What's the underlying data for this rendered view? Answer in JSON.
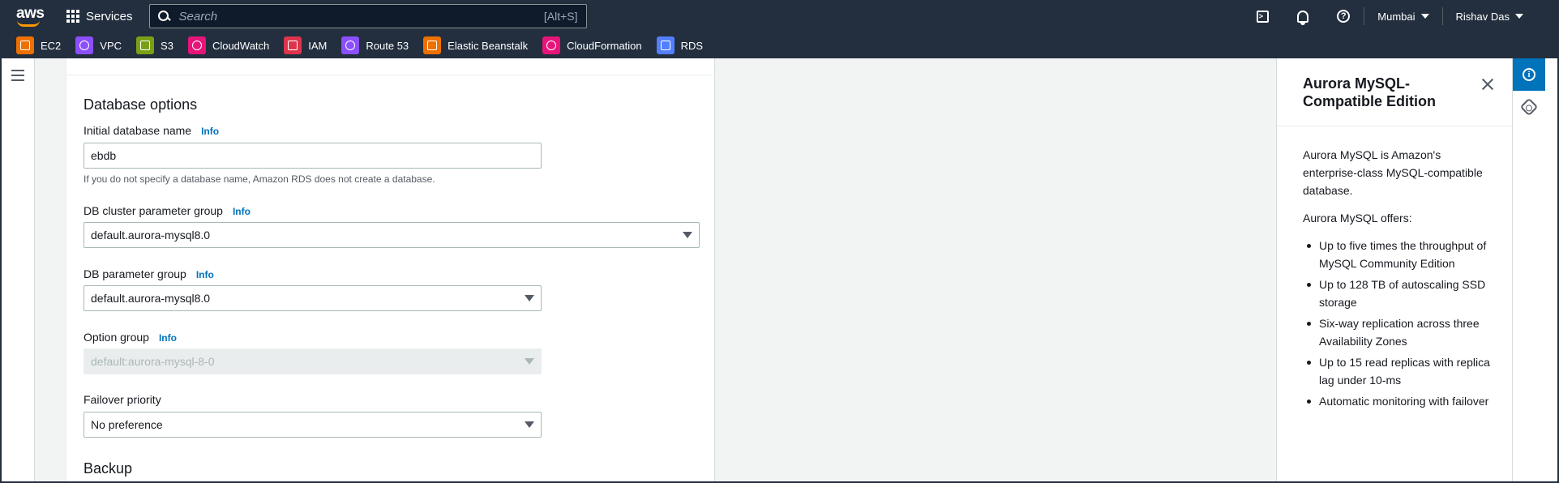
{
  "topnav": {
    "logo_text": "aws",
    "services_label": "Services",
    "search_placeholder": "Search",
    "search_shortcut": "[Alt+S]",
    "region": "Mumbai",
    "user": "Rishav Das"
  },
  "favorites": [
    {
      "label": "EC2",
      "color": "#ed7100",
      "icon": "ec2-icon"
    },
    {
      "label": "VPC",
      "color": "#8c4fff",
      "icon": "vpc-icon"
    },
    {
      "label": "S3",
      "color": "#7aa116",
      "icon": "s3-icon"
    },
    {
      "label": "CloudWatch",
      "color": "#e7157b",
      "icon": "cloudwatch-icon"
    },
    {
      "label": "IAM",
      "color": "#dd344c",
      "icon": "iam-icon"
    },
    {
      "label": "Route 53",
      "color": "#8c4fff",
      "icon": "route53-icon"
    },
    {
      "label": "Elastic Beanstalk",
      "color": "#ed7100",
      "icon": "beanstalk-icon"
    },
    {
      "label": "CloudFormation",
      "color": "#e7157b",
      "icon": "cloudformation-icon"
    },
    {
      "label": "RDS",
      "color": "#527fff",
      "icon": "rds-icon"
    }
  ],
  "form": {
    "section_title": "Database options",
    "info_label": "Info",
    "db_name": {
      "label": "Initial database name",
      "value": "ebdb",
      "hint": "If you do not specify a database name, Amazon RDS does not create a database."
    },
    "cluster_param_group": {
      "label": "DB cluster parameter group",
      "value": "default.aurora-mysql8.0"
    },
    "db_param_group": {
      "label": "DB parameter group",
      "value": "default.aurora-mysql8.0"
    },
    "option_group": {
      "label": "Option group",
      "value": "default:aurora-mysql-8-0"
    },
    "failover": {
      "label": "Failover priority",
      "value": "No preference"
    },
    "next_section": "Backup"
  },
  "help": {
    "title": "Aurora MySQL-Compatible Edition",
    "intro": "Aurora MySQL is Amazon's enterprise-class MySQL-compatible database.",
    "offers_label": "Aurora MySQL offers:",
    "bullets": [
      "Up to five times the throughput of MySQL Community Edition",
      "Up to 128 TB of autoscaling SSD storage",
      "Six-way replication across three Availability Zones",
      "Up to 15 read replicas with replica lag under 10-ms",
      "Automatic monitoring with failover"
    ]
  },
  "colors": {
    "nav_bg": "#232f3e",
    "link": "#0073bb",
    "accent": "#ff9900"
  }
}
